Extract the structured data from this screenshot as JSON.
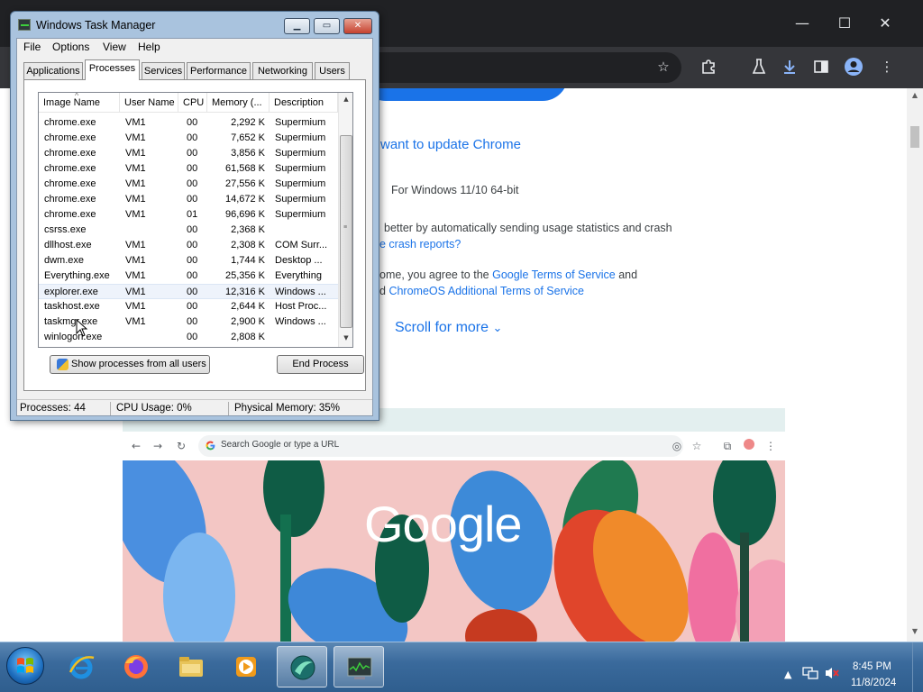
{
  "chrome": {
    "window_controls": {
      "minimize": "—",
      "maximize": "☐",
      "close": "✕"
    },
    "toolbar_icons": [
      "star-icon",
      "extensions-icon",
      "labs-icon",
      "download-icon",
      "sidebar-icon",
      "profile-icon",
      "menu-icon"
    ],
    "content": {
      "heading": "want to update Chrome",
      "platform": "For Windows 11/10 64-bit",
      "usage_text": "better by automatically sending usage statistics and crash",
      "crash_link": "e crash reports?",
      "terms_prefix": "ome, you agree to the ",
      "terms_link": "Google Terms of Service",
      "terms_suffix": " and",
      "chromeos_prefix": "d ",
      "chromeos_link": "ChromeOS Additional Terms of Service",
      "scroll_label": "Scroll for more",
      "scroll_chevron": "⌄"
    },
    "illustration": {
      "search_placeholder": "Search Google or type a URL",
      "logo_text": "Google"
    }
  },
  "task_manager": {
    "title": "Windows Task Manager",
    "controls": {
      "minimize": "▁",
      "maximize": "▭",
      "close": "✕"
    },
    "menu": [
      "File",
      "Options",
      "View",
      "Help"
    ],
    "tabs": [
      "Applications",
      "Processes",
      "Services",
      "Performance",
      "Networking",
      "Users"
    ],
    "active_tab": "Processes",
    "columns": [
      "Image Name",
      "User Name",
      "CPU",
      "Memory (...",
      "Description"
    ],
    "sort_indicator": "^",
    "rows": [
      {
        "image": "chrome.exe",
        "user": "VM1",
        "cpu": "00",
        "memory": "2,292 K",
        "desc": "Supermium"
      },
      {
        "image": "chrome.exe",
        "user": "VM1",
        "cpu": "00",
        "memory": "7,652 K",
        "desc": "Supermium"
      },
      {
        "image": "chrome.exe",
        "user": "VM1",
        "cpu": "00",
        "memory": "3,856 K",
        "desc": "Supermium"
      },
      {
        "image": "chrome.exe",
        "user": "VM1",
        "cpu": "00",
        "memory": "61,568 K",
        "desc": "Supermium"
      },
      {
        "image": "chrome.exe",
        "user": "VM1",
        "cpu": "00",
        "memory": "27,556 K",
        "desc": "Supermium"
      },
      {
        "image": "chrome.exe",
        "user": "VM1",
        "cpu": "00",
        "memory": "14,672 K",
        "desc": "Supermium"
      },
      {
        "image": "chrome.exe",
        "user": "VM1",
        "cpu": "01",
        "memory": "96,696 K",
        "desc": "Supermium"
      },
      {
        "image": "csrss.exe",
        "user": "",
        "cpu": "00",
        "memory": "2,368 K",
        "desc": ""
      },
      {
        "image": "dllhost.exe",
        "user": "VM1",
        "cpu": "00",
        "memory": "2,308 K",
        "desc": "COM Surr..."
      },
      {
        "image": "dwm.exe",
        "user": "VM1",
        "cpu": "00",
        "memory": "1,744 K",
        "desc": "Desktop ..."
      },
      {
        "image": "Everything.exe",
        "user": "VM1",
        "cpu": "00",
        "memory": "25,356 K",
        "desc": "Everything"
      },
      {
        "image": "explorer.exe",
        "user": "VM1",
        "cpu": "00",
        "memory": "12,316 K",
        "desc": "Windows ..."
      },
      {
        "image": "taskhost.exe",
        "user": "VM1",
        "cpu": "00",
        "memory": "2,644 K",
        "desc": "Host Proc..."
      },
      {
        "image": "taskmgr.exe",
        "user": "VM1",
        "cpu": "00",
        "memory": "2,900 K",
        "desc": "Windows ..."
      },
      {
        "image": "winlogon.exe",
        "user": "",
        "cpu": "00",
        "memory": "2,808 K",
        "desc": ""
      }
    ],
    "selected_row": 11,
    "show_all_button": "Show processes from all users",
    "end_process_button": "End Process",
    "status": {
      "processes": "Processes: 44",
      "cpu": "CPU Usage: 0%",
      "memory": "Physical Memory: 35%"
    }
  },
  "taskbar": {
    "apps": [
      "internet-explorer-icon",
      "firefox-icon",
      "file-explorer-icon",
      "media-player-icon",
      "browser-icon",
      "task-manager-icon"
    ],
    "active_apps": [
      "browser-icon",
      "task-manager-icon"
    ],
    "clock": {
      "time": "8:45 PM",
      "date": "11/8/2024"
    },
    "tray_icons": [
      "show-hidden-icons-arrow",
      "network-icon",
      "volume-muted-icon"
    ]
  }
}
